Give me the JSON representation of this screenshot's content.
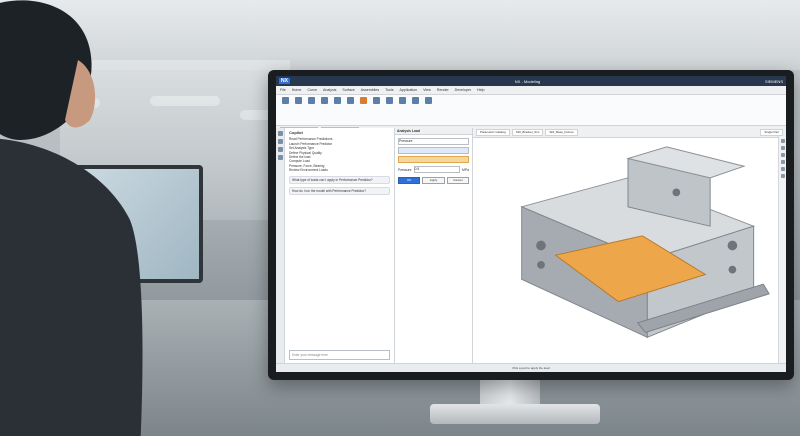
{
  "app": {
    "logo": "NX",
    "window_title": "NX - Modeling",
    "user": "SIEMENS"
  },
  "menu": [
    "File",
    "Home",
    "Curve",
    "Analysis",
    "Surface",
    "Assemblies",
    "Tools",
    "Application",
    "View",
    "Render",
    "Developer",
    "Help"
  ],
  "copilot": {
    "title": "Copilot",
    "lines": [
      "Read Performance Predictions",
      "Launch Performance Predictor",
      "Set Analysis Type",
      "Define Physical Quality",
      "Define the load",
      "Compute Load",
      "Pressure, Force, Bearing",
      "Review Environment Loads"
    ],
    "messages": [
      "What type of loads can I apply in Performance Predictor?",
      "How do I run the model with Performance Predictor?"
    ],
    "input_placeholder": "Enter your message here"
  },
  "dialog": {
    "title": "Analysis Load",
    "type_value": "Pressure",
    "pressure_label": "Pressure",
    "pressure_value": "0.5",
    "pressure_unit": "MPa",
    "buttons": [
      "OK",
      "Apply",
      "Cancel"
    ]
  },
  "viewport": {
    "tab_labels": [
      "Parametric Catalog",
      "SDI_Bracket_Sim",
      "SDI_Base_Fixture"
    ],
    "filter_label": "Single Part"
  },
  "status": "Pick a part to apply the load"
}
